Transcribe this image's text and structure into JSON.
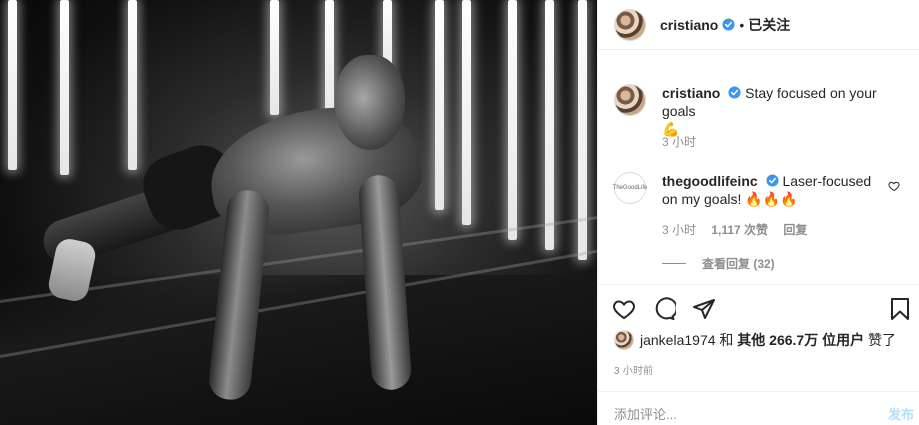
{
  "post": {
    "username": "cristiano",
    "follow_status": "已关注",
    "separator": "•",
    "caption_text": "Stay focused on your goals",
    "caption_emoji": "💪",
    "caption_time": "3 小时"
  },
  "comments": [
    {
      "username": "thegoodlifeinc",
      "logo_text": "TheGoodLife",
      "text_line1": "Laser-focused",
      "text_line2": "on my goals!",
      "emoji": "🔥🔥🔥",
      "time": "3 小时",
      "likes": "1,117 次赞",
      "reply_label": "回复",
      "view_replies": "查看回复 (32)"
    }
  ],
  "likes_line": {
    "user": "jankela1974",
    "joiner": " 和 ",
    "others": "其他 266.7万 位用户",
    "suffix": " 赞了"
  },
  "time_ago": "3 小时前",
  "add_comment": {
    "placeholder": "添加评论...",
    "post_label": "发布"
  },
  "colors": {
    "verified": "#3897f0",
    "post_button_disabled": "#b2dffc",
    "secondary_text": "#8e8e8e"
  }
}
